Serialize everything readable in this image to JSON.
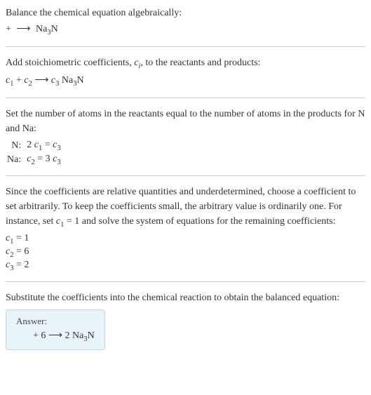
{
  "section1": {
    "line1": "Balance the chemical equation algebraically:",
    "eq_plus": " + ",
    "eq_arrow": "⟶",
    "eq_product": "Na",
    "eq_product_sub": "3",
    "eq_product_end": "N"
  },
  "section2": {
    "line1_a": "Add stoichiometric coefficients, ",
    "line1_ci": "c",
    "line1_ci_sub": "i",
    "line1_b": ", to the reactants and products:",
    "c1": "c",
    "c1_sub": "1",
    "plus1": " + ",
    "c2": "c",
    "c2_sub": "2",
    "arrow": " ⟶ ",
    "c3": "c",
    "c3_sub": "3",
    "prod": " Na",
    "prod_sub": "3",
    "prod_end": "N"
  },
  "section3": {
    "line1": "Set the number of atoms in the reactants equal to the number of atoms in the products for N and Na:",
    "rows": [
      {
        "elem": "N:",
        "lhs_coef": "2 ",
        "lhs_c": "c",
        "lhs_sub": "1",
        "eq": " = ",
        "rhs_c": "c",
        "rhs_sub": "3",
        "rhs_pre": ""
      },
      {
        "elem": "Na:",
        "lhs_coef": "",
        "lhs_c": "c",
        "lhs_sub": "2",
        "eq": " = 3 ",
        "rhs_c": "c",
        "rhs_sub": "3",
        "rhs_pre": ""
      }
    ]
  },
  "section4": {
    "line1": "Since the coefficients are relative quantities and underdetermined, choose a coefficient to set arbitrarily. To keep the coefficients small, the arbitrary value is ordinarily one. For instance, set ",
    "c1": "c",
    "c1_sub": "1",
    "line1b": " = 1 and solve the system of equations for the remaining coefficients:",
    "coefs": [
      {
        "c": "c",
        "sub": "1",
        "val": " = 1"
      },
      {
        "c": "c",
        "sub": "2",
        "val": " = 6"
      },
      {
        "c": "c",
        "sub": "3",
        "val": " = 2"
      }
    ]
  },
  "section5": {
    "line1": "Substitute the coefficients into the chemical reaction to obtain the balanced equation:",
    "answer_label": "Answer:",
    "ans_a": " + 6 ",
    "ans_arrow": " ⟶ ",
    "ans_b": "2 Na",
    "ans_sub": "3",
    "ans_c": "N"
  },
  "chart_data": {
    "type": "table",
    "title": "Balanced chemical equation for formation of Na3N",
    "stoichiometric_coefficients": {
      "c1": 1,
      "c2": 6,
      "c3": 2
    },
    "atom_balance": [
      {
        "element": "N",
        "equation": "2 c1 = c3"
      },
      {
        "element": "Na",
        "equation": "c2 = 3 c3"
      }
    ],
    "balanced_equation": "+ 6  ⟶ 2 Na3N"
  }
}
